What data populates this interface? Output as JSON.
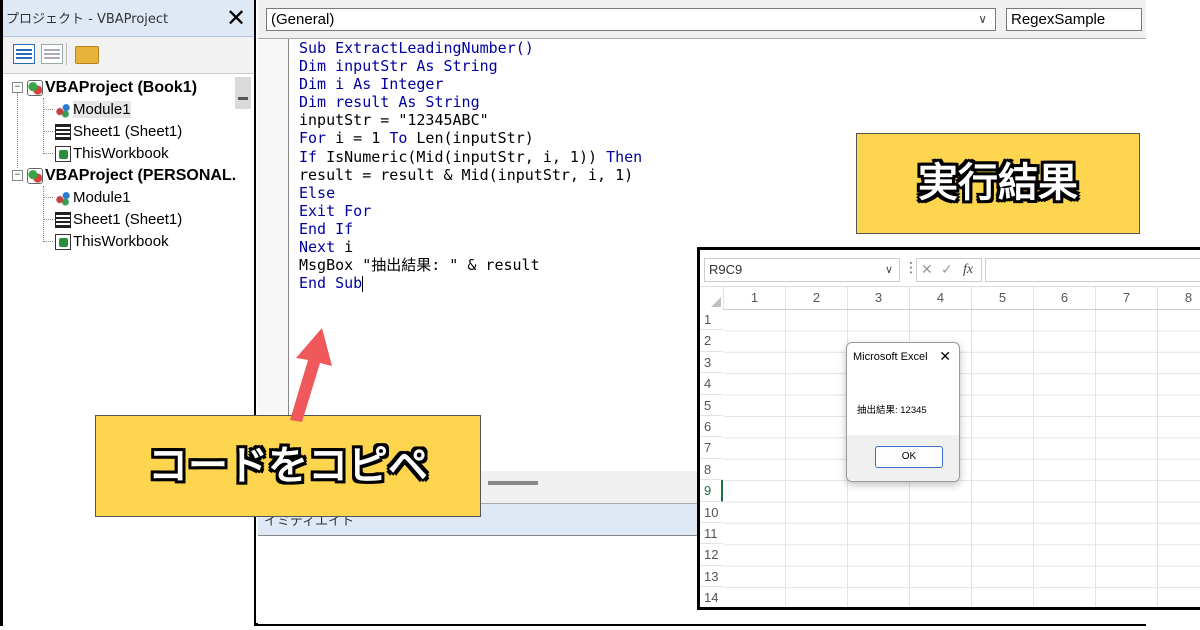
{
  "project_explorer": {
    "title": "プロジェクト - VBAProject",
    "close_glyph": "✕",
    "tree": [
      {
        "label": "VBAProject (Book1)",
        "kind": "project",
        "expander": "−"
      },
      {
        "label": "Module1",
        "kind": "module",
        "selected": true
      },
      {
        "label": "Sheet1 (Sheet1)",
        "kind": "sheet"
      },
      {
        "label": "ThisWorkbook",
        "kind": "workbook"
      },
      {
        "label": "VBAProject (PERSONAL.",
        "kind": "project",
        "expander": "−"
      },
      {
        "label": "Module1",
        "kind": "module"
      },
      {
        "label": "Sheet1 (Sheet1)",
        "kind": "sheet"
      },
      {
        "label": "ThisWorkbook",
        "kind": "workbook"
      }
    ]
  },
  "code_window": {
    "object_combo": "(General)",
    "object_combo_arrow": "∨",
    "procedure_combo": "RegexSample",
    "lines": [
      [
        {
          "t": "Sub ",
          "kw": true
        },
        {
          "t": "ExtractLeadingNumber()",
          "kw": true
        }
      ],
      [
        {
          "t": "Dim ",
          "kw": true
        },
        {
          "t": "inputStr ",
          "kw": true
        },
        {
          "t": "As String",
          "kw": true
        }
      ],
      [
        {
          "t": "Dim ",
          "kw": true
        },
        {
          "t": "i ",
          "kw": true
        },
        {
          "t": "As Integer",
          "kw": true
        }
      ],
      [
        {
          "t": "Dim ",
          "kw": true
        },
        {
          "t": "result ",
          "kw": true
        },
        {
          "t": "As String",
          "kw": true
        }
      ],
      [
        {
          "t": "inputStr = \"12345ABC\"",
          "kw": false
        }
      ],
      [
        {
          "t": "For ",
          "kw": true
        },
        {
          "t": "i = 1 ",
          "kw": false
        },
        {
          "t": "To ",
          "kw": true
        },
        {
          "t": "Len(inputStr)",
          "kw": false
        }
      ],
      [
        {
          "t": "If ",
          "kw": true
        },
        {
          "t": "IsNumeric(Mid(inputStr, i, 1)) ",
          "kw": false
        },
        {
          "t": "Then",
          "kw": true
        }
      ],
      [
        {
          "t": "result = result & Mid(inputStr, i, 1)",
          "kw": false
        }
      ],
      [
        {
          "t": "Else",
          "kw": true
        }
      ],
      [
        {
          "t": "Exit For",
          "kw": true
        }
      ],
      [
        {
          "t": "End If",
          "kw": true
        }
      ],
      [
        {
          "t": "Next ",
          "kw": true
        },
        {
          "t": "i",
          "kw": false
        }
      ],
      [
        {
          "t": "MsgBox \"抽出結果: \" & result",
          "kw": false
        }
      ],
      [
        {
          "t": "End Sub",
          "kw": true
        }
      ]
    ]
  },
  "immediate_title": "イミディエイト",
  "callouts": {
    "result": "実行結果",
    "copy": "コードをコピペ",
    "fill_color": "#fdd54e"
  },
  "excel": {
    "name_box": "R9C9",
    "formula_icons": [
      "✕",
      "✓",
      "fx"
    ],
    "columns": [
      "1",
      "2",
      "3",
      "4",
      "5",
      "6",
      "7",
      "8"
    ],
    "rows": [
      "1",
      "2",
      "3",
      "4",
      "5",
      "6",
      "7",
      "8",
      "9",
      "10",
      "11",
      "12",
      "13",
      "14"
    ],
    "active_row": "9",
    "msgbox": {
      "title": "Microsoft Excel",
      "message": "抽出結果: 12345",
      "ok_label": "OK"
    }
  },
  "colors": {
    "keyword": "#0000a0",
    "arrow": "#f0595b",
    "excel_green": "#1e7145"
  }
}
